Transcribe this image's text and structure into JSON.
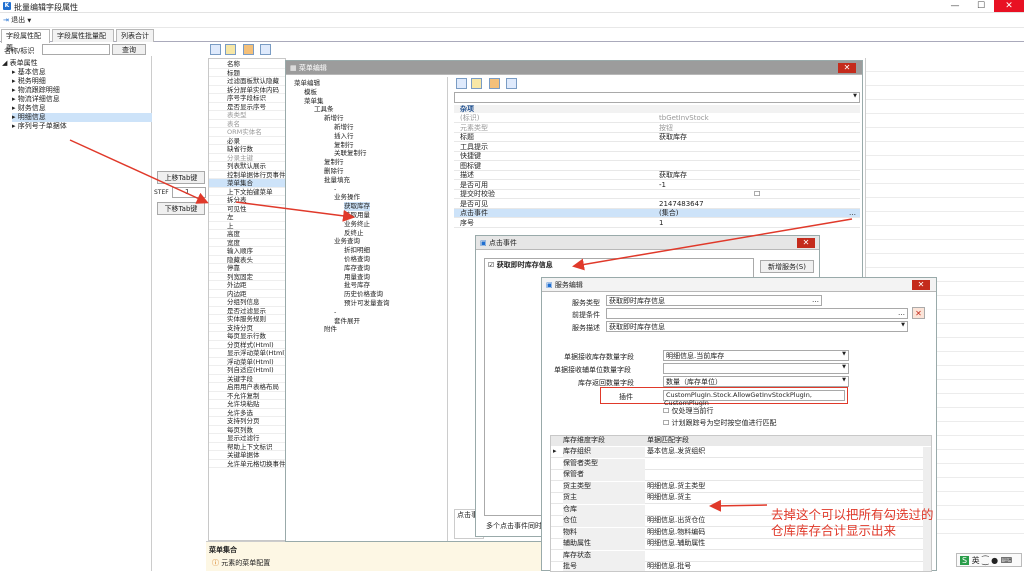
{
  "window": {
    "title": "批量编辑字段属性",
    "min": "—",
    "max": "☐",
    "close": "✕"
  },
  "menubar": {
    "exit_label": "退出"
  },
  "tabs": [
    {
      "label": "字段属性配置"
    },
    {
      "label": "字段属性批量配置"
    },
    {
      "label": "列表合计"
    }
  ],
  "search": {
    "label": "名称/标识",
    "value": "",
    "button": "查询"
  },
  "tree": {
    "root": "表单属性",
    "items": [
      "基本信息",
      "税务明细",
      "物流跟踪明细",
      "物流详细信息",
      "财务信息",
      "明细信息",
      "序列号子单据体"
    ]
  },
  "move": {
    "up": "上移Tab键",
    "step_label": "STEF",
    "step_value": "1",
    "down": "下移Tab键"
  },
  "props": {
    "items": [
      "名称",
      "标题",
      "过滤面板默认隐藏",
      "拆分屏单实体内码",
      "序号字段标识",
      "是否显示序号",
      "表类型",
      "表名",
      "ORM实体名",
      "必录",
      "缺省行数",
      "分录主键",
      "列表默认展示",
      "控制单据体行页事件",
      "菜单集合",
      "上下文拍键菜单",
      "拆分表",
      "可见性",
      "左",
      "上",
      "高度",
      "宽度",
      "输入顺序",
      "隐藏表头",
      "停靠",
      "列宽固定",
      "外边距",
      "内边距",
      "分组列信息",
      "是否过滤显示",
      "实体服务规则",
      "支持分页",
      "每页显示行数",
      "分页样式(Html)",
      "显示浮动菜单(Html)",
      "浮动菜单(Html)",
      "列自适应(Html)",
      "关键字段",
      "启用用户表格布局",
      "不允许复制",
      "允许块粘贴",
      "允许多选",
      "支持列分页",
      "每页列数",
      "显示过滤行",
      "帮助上下文标识",
      "关键单据体",
      "允许单元格切换事件"
    ],
    "footer_title": "菜单集合",
    "footer_desc": "元素的菜单配置"
  },
  "menuEditor": {
    "title": "菜单编辑",
    "close": "✕",
    "tree": [
      "菜单编辑",
      "模板",
      "菜单集",
      "工具条",
      "新增行",
      "新增行",
      "插入行",
      "复制行",
      "关联复制行",
      "复制行",
      "删除行",
      "批量填充",
      "-",
      "业务操作",
      "获取库存",
      "获取用量",
      "业务终止",
      "反终止",
      "业务查询",
      "折扣明细",
      "价格查询",
      "库存查询",
      "用量查询",
      "批号库存",
      "历史价格查询",
      "预计可发量查询",
      "-",
      "套件展开",
      "附件"
    ],
    "section": "杂项",
    "props": [
      {
        "k": "(标识)",
        "v": "tbGetInvStock",
        "dim": true
      },
      {
        "k": "元素类型",
        "v": "按钮",
        "dim": true
      },
      {
        "k": "标题",
        "v": "获取库存",
        "dim": false
      },
      {
        "k": "工具提示",
        "v": "",
        "dim": false
      },
      {
        "k": "快捷键",
        "v": "",
        "dim": false
      },
      {
        "k": "图标键",
        "v": "",
        "dim": false
      },
      {
        "k": "描述",
        "v": "获取库存",
        "dim": false
      },
      {
        "k": "是否可用",
        "v": "-1",
        "dim": false
      },
      {
        "k": "提交时校验",
        "v": "",
        "dim": false
      },
      {
        "k": "是否可见",
        "v": "2147483647",
        "dim": false
      },
      {
        "k": "点击事件",
        "v": "(集合)",
        "dim": false
      },
      {
        "k": "序号",
        "v": "1",
        "dim": false
      }
    ],
    "bottom_label": "点击事"
  },
  "clickEvent": {
    "title": "点击事件",
    "close": "✕",
    "item": "获取即时库存信息",
    "new_button": "新增服务(S)",
    "footer": "多个点击事件同时"
  },
  "serviceEditor": {
    "title": "服务编辑",
    "close": "✕",
    "service_type_label": "服务类型",
    "service_type_value": "获取即时库存信息",
    "precondition_label": "前提条件",
    "precondition_value": "",
    "desc_label": "服务描述",
    "desc_value": "获取即时库存信息",
    "fields": [
      {
        "k": "单据接收库存数量字段",
        "v": "明细信息.当前库存"
      },
      {
        "k": "单据接收辅单位数量字段",
        "v": ""
      },
      {
        "k": "库存返回数量字段",
        "v": "数量（库存单位）"
      }
    ],
    "plugin_label": "插件",
    "plugin_value": "CustomPlugIn.Stock.AllowGetInvStockPlugIn, CustomPlugIn",
    "check1": "仅处理当前行",
    "check2": "计划跟踪号为空时按空值进行匹配",
    "grid_headers": [
      "库存维度字段",
      "单据匹配字段"
    ],
    "grid_rows": [
      {
        "a": "库存组织",
        "b": "基本信息.发货组织"
      },
      {
        "a": "保管者类型",
        "b": ""
      },
      {
        "a": "保管者",
        "b": ""
      },
      {
        "a": "货主类型",
        "b": "明细信息.货主类型"
      },
      {
        "a": "货主",
        "b": "明细信息.货主"
      },
      {
        "a": "仓库",
        "b": ""
      },
      {
        "a": "仓位",
        "b": "明细信息.出货仓位"
      },
      {
        "a": "物料",
        "b": "明细信息.物料编码"
      },
      {
        "a": "辅助属性",
        "b": "明细信息.辅助属性"
      },
      {
        "a": "库存状态",
        "b": ""
      },
      {
        "a": "批号",
        "b": "明细信息.批号"
      }
    ]
  },
  "annotation": "去掉这个可以把所有勾选过的仓库库存合计显示出来",
  "ime": {
    "label": "英"
  },
  "colors": {
    "accent": "#1f6fd1",
    "arrow": "#e0392a",
    "close": "#c42b1c"
  }
}
